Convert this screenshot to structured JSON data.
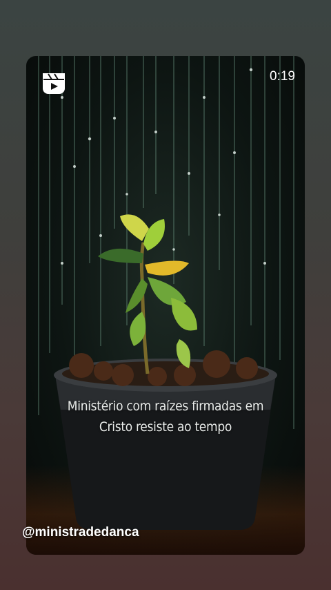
{
  "video": {
    "duration_label": "0:19",
    "caption_line1": "Ministério com raízes firmadas em",
    "caption_line2": "Cristo resiste ao tempo",
    "author_handle": "@ministradedanca"
  },
  "icons": {
    "reels": "reels-icon"
  },
  "colors": {
    "background_top": "#3b4442",
    "background_bottom": "#4a302f",
    "text": "#ffffff"
  }
}
